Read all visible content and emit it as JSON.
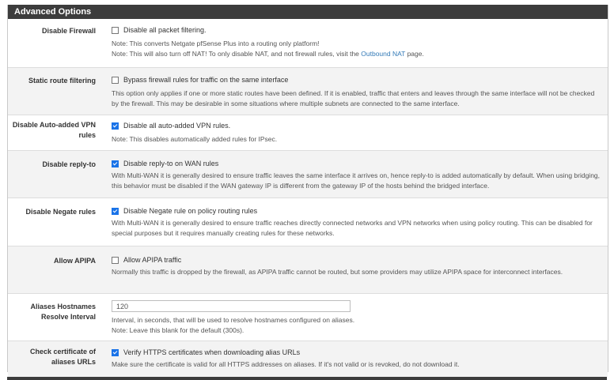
{
  "panel": {
    "title": "Advanced Options"
  },
  "rows": [
    {
      "label": "Disable Firewall",
      "checkbox_label": "Disable all packet filtering.",
      "checked": false,
      "help": [
        "Note: This converts Netgate pfSense Plus into a routing only platform!",
        {
          "before": "Note: This will also turn off NAT! To only disable NAT, and not firewall rules, visit the ",
          "link": "Outbound NAT",
          "after": " page."
        }
      ]
    },
    {
      "label": "Static route filtering",
      "checkbox_label": "Bypass firewall rules for traffic on the same interface",
      "checked": false,
      "help": "This option only applies if one or more static routes have been defined. If it is enabled, traffic that enters and leaves through the same interface will not be checked by the firewall. This may be desirable in some situations where multiple subnets are connected to the same interface."
    },
    {
      "label_line1": "Disable Auto-added VPN",
      "label_line2": "rules",
      "checkbox_label": "Disable all auto-added VPN rules.",
      "checked": true,
      "help": "Note: This disables automatically added rules for IPsec."
    },
    {
      "label": "Disable reply-to",
      "checkbox_label": "Disable reply-to on WAN rules",
      "checked": true,
      "help": "With Multi-WAN it is generally desired to ensure traffic leaves the same interface it arrives on, hence reply-to is added automatically by default. When using bridging, this behavior must be disabled if the WAN gateway IP is different from the gateway IP of the hosts behind the bridged interface."
    },
    {
      "label": "Disable Negate rules",
      "checkbox_label": "Disable Negate rule on policy routing rules",
      "checked": true,
      "help": "With Multi-WAN it is generally desired to ensure traffic reaches directly connected networks and VPN networks when using policy routing. This can be disabled for special purposes but it requires manually creating rules for these networks."
    },
    {
      "label": "Allow APIPA",
      "checkbox_label": "Allow APIPA traffic",
      "checked": false,
      "help": "Normally this traffic is dropped by the firewall, as APIPA traffic cannot be routed, but some providers may utilize APIPA space for interconnect interfaces."
    },
    {
      "label_line1": "Aliases Hostnames",
      "label_line2": "Resolve Interval",
      "input_value": "120",
      "help": [
        "Interval, in seconds, that will be used to resolve hostnames configured on aliases.",
        "Note: Leave this blank for the default (300s)."
      ]
    },
    {
      "label_line1": "Check certificate of",
      "label_line2": "aliases URLs",
      "checkbox_label": "Verify HTTPS certificates when downloading alias URLs",
      "checked": true,
      "help": "Make sure the certificate is valid for all HTTPS addresses on aliases. If it's not valid or is revoked, do not download it."
    }
  ],
  "colors": {
    "heading_bg": "#3c3c3c",
    "checkbox_checked": "#1a73e8",
    "link": "#337ab7",
    "highlight": "#ffff4d"
  }
}
